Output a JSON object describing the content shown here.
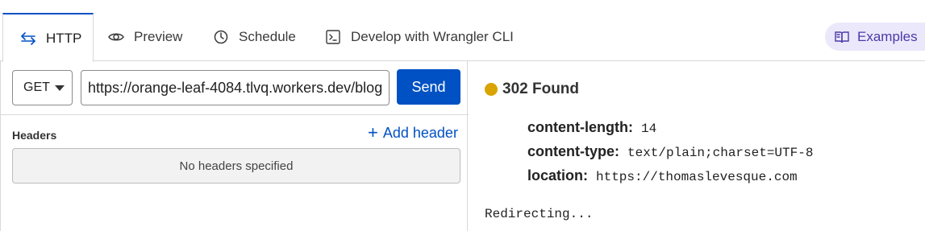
{
  "tabs": [
    {
      "label": "HTTP",
      "icon": "arrows-exchange-icon",
      "active": true
    },
    {
      "label": "Preview",
      "icon": "eye-icon",
      "active": false
    },
    {
      "label": "Schedule",
      "icon": "clock-icon",
      "active": false
    },
    {
      "label": "Develop with Wrangler CLI",
      "icon": "terminal-icon",
      "active": false
    }
  ],
  "examples": {
    "label": "Examples",
    "icon": "book-open-icon"
  },
  "request": {
    "method": "GET",
    "url": "https://orange-leaf-4084.tlvq.workers.dev/blog",
    "send_label": "Send"
  },
  "headers": {
    "title": "Headers",
    "add_label": "Add header",
    "empty_text": "No headers specified"
  },
  "response": {
    "status": "302 Found",
    "status_color": "#d9a400",
    "headers": [
      {
        "key": "content-length:",
        "value": "14"
      },
      {
        "key": "content-type:",
        "value": "text/plain;charset=UTF-8"
      },
      {
        "key": "location:",
        "value": "https://thomaslevesque.com"
      }
    ],
    "body": "Redirecting..."
  },
  "colors": {
    "accent": "#0051c3",
    "examples_bg": "#ece8fb",
    "examples_text": "#4a3aa8"
  }
}
